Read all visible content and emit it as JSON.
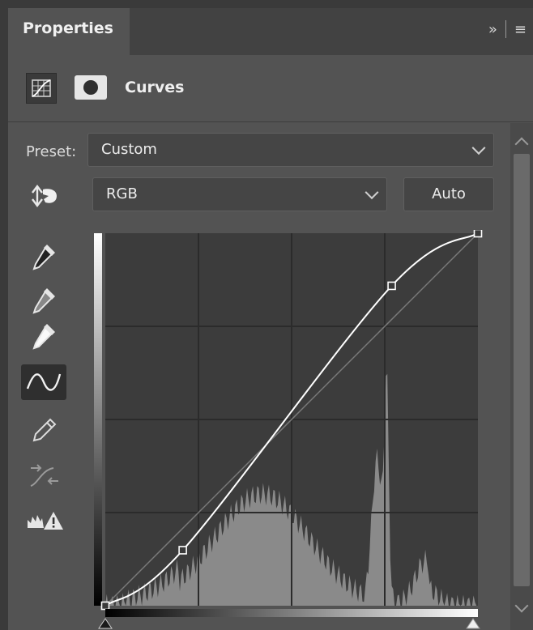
{
  "panel": {
    "tab_title": "Properties",
    "tab_actions": [
      "»",
      "≡"
    ]
  },
  "header": {
    "title": "Curves",
    "icons": [
      "curves-adjustment-icon",
      "layer-mask-icon"
    ]
  },
  "preset": {
    "label": "Preset:",
    "value": "Custom"
  },
  "channel": {
    "value": "RGB",
    "auto_label": "Auto"
  },
  "tools": [
    {
      "name": "on-image-adjust-icon",
      "active": false
    },
    {
      "name": "black-point-eyedropper-icon",
      "active": false
    },
    {
      "name": "gray-point-eyedropper-icon",
      "active": false
    },
    {
      "name": "white-point-eyedropper-icon",
      "active": false
    },
    {
      "name": "curve-points-icon",
      "active": true
    },
    {
      "name": "pencil-draw-icon",
      "active": false
    },
    {
      "name": "smooth-curve-icon",
      "active": false
    },
    {
      "name": "clipping-warning-icon",
      "active": false
    }
  ],
  "curve": {
    "input_range": [
      0,
      255
    ],
    "output_range": [
      0,
      255
    ],
    "control_points": [
      {
        "input": 0,
        "output": 0
      },
      {
        "input": 53,
        "output": 38
      },
      {
        "input": 196,
        "output": 219
      },
      {
        "input": 255,
        "output": 255
      }
    ],
    "histogram_color": "#8a8a8a",
    "curve_color": "#ffffff"
  },
  "colors": {
    "panel_bg": "#535353",
    "graph_bg": "#3c3c3c",
    "tabbar_bg": "#424242"
  }
}
